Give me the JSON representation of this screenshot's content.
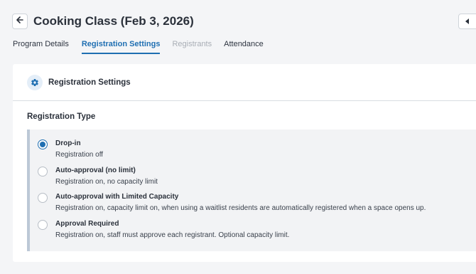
{
  "header": {
    "title": "Cooking Class (Feb 3, 2026)",
    "back_icon": "arrow-left-icon",
    "collapse_icon": "caret-left-icon"
  },
  "tabs": [
    {
      "label": "Program Details",
      "state": "normal"
    },
    {
      "label": "Registration Settings",
      "state": "active"
    },
    {
      "label": "Registrants",
      "state": "disabled"
    },
    {
      "label": "Attendance",
      "state": "normal"
    }
  ],
  "card": {
    "icon": "gear-icon",
    "title": "Registration Settings",
    "section_title": "Registration Type",
    "options": [
      {
        "label": "Drop-in",
        "description": "Registration off",
        "selected": true
      },
      {
        "label": "Auto-approval (no limit)",
        "description": "Registration on, no capacity limit",
        "selected": false
      },
      {
        "label": "Auto-approval with Limited Capacity",
        "description": "Registration on, capacity limit on, when using a waitlist residents are automatically registered when a space opens up.",
        "selected": false
      },
      {
        "label": "Approval Required",
        "description": "Registration on, staff must approve each registrant. Optional capacity limit.",
        "selected": false
      }
    ]
  },
  "colors": {
    "accent": "#1f6fb2",
    "background": "#f4f5f7",
    "card": "#ffffff",
    "disabled_text": "#a8adb5"
  }
}
